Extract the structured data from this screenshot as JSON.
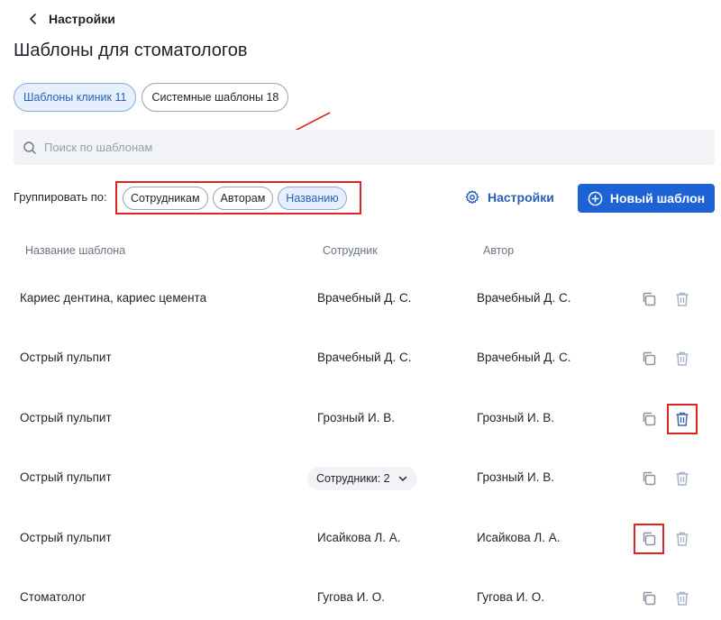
{
  "header": {
    "back_label": "Настройки",
    "title": "Шаблоны для стоматологов"
  },
  "tabs": [
    {
      "label": "Шаблоны клиник 11",
      "active": true
    },
    {
      "label": "Системные шаблоны 18",
      "active": false
    }
  ],
  "search": {
    "placeholder": "Поиск по шаблонам",
    "value": ""
  },
  "group": {
    "label": "Группировать по:",
    "options": [
      {
        "label": "Сотрудникам",
        "active": false
      },
      {
        "label": "Авторам",
        "active": false
      },
      {
        "label": "Названию",
        "active": true
      }
    ]
  },
  "toolbar": {
    "settings_label": "Настройки",
    "new_label": "Новый шаблон"
  },
  "table": {
    "headers": {
      "name": "Название шаблона",
      "employee": "Сотрудник",
      "author": "Автор"
    },
    "rows": [
      {
        "name": "Кариес дентина, кариес цемента",
        "employee": "Врачебный Д. С.",
        "author": "Врачебный Д. С.",
        "trash_enabled": false
      },
      {
        "name": "Острый пульпит",
        "employee": "Врачебный Д. С.",
        "author": "Врачебный Д. С.",
        "trash_enabled": false
      },
      {
        "name": "Острый пульпит",
        "employee": "Грозный И. В.",
        "author": "Грозный И. В.",
        "trash_enabled": true
      },
      {
        "name": "Острый пульпит",
        "employee": "Сотрудники: 2",
        "author": "Грозный И. В.",
        "trash_enabled": false
      },
      {
        "name": "Острый пульпит",
        "employee": "Исайкова Л. А.",
        "author": "Исайкова Л. А.",
        "trash_enabled": false
      },
      {
        "name": "Стоматолог",
        "employee": "Гугова И. О.",
        "author": "Гугова И. О.",
        "trash_enabled": false
      }
    ]
  },
  "colors": {
    "accent": "#1d63d6",
    "annotation": "#e02424",
    "muted_icon": "#a7b4c8",
    "active_icon": "#3b68b3"
  }
}
